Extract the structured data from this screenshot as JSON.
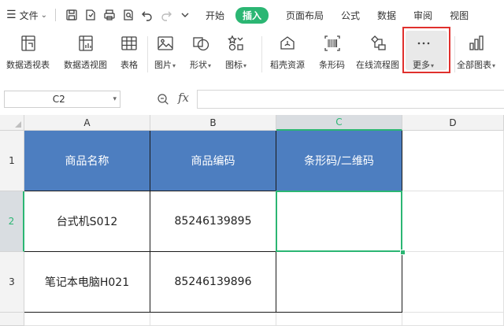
{
  "menubar": {
    "file_label": "文件",
    "tabs": [
      "开始",
      "插入",
      "页面布局",
      "公式",
      "数据",
      "审阅",
      "视图"
    ],
    "active_tab": "插入"
  },
  "ribbon": {
    "buttons": [
      {
        "label": "数据透视表",
        "icon": "pivot-table-icon"
      },
      {
        "label": "数据透视图",
        "icon": "pivot-chart-icon"
      },
      {
        "label": "表格",
        "icon": "table-icon"
      },
      {
        "label": "图片",
        "icon": "picture-icon"
      },
      {
        "label": "形状",
        "icon": "shapes-icon"
      },
      {
        "label": "图标",
        "icon": "icons-icon"
      },
      {
        "label": "稻壳资源",
        "icon": "docer-resources-icon"
      },
      {
        "label": "条形码",
        "icon": "barcode-icon"
      },
      {
        "label": "在线流程图",
        "icon": "flowchart-icon"
      },
      {
        "label": "更多",
        "icon": "more-dots-icon"
      },
      {
        "label": "全部图表",
        "icon": "all-charts-icon"
      }
    ]
  },
  "formula_bar": {
    "name_box": "C2",
    "fx_label": "fx",
    "formula_value": ""
  },
  "grid": {
    "columns": [
      "A",
      "B",
      "C",
      "D"
    ],
    "rows": [
      "1",
      "2",
      "3"
    ],
    "selected_column": "C",
    "selected_row": "2",
    "cells": {
      "A1": "商品名称",
      "B1": "商品编码",
      "C1": "条形码/二维码",
      "A2": "台式机S012",
      "B2": "85246139895",
      "C2": "",
      "A3": "笔记本电脑H021",
      "B3": "85246139896",
      "C3": ""
    }
  },
  "colors": {
    "accent_green": "#2bb673",
    "header_blue": "#4d7ec0",
    "highlight_red": "#e0302d"
  }
}
